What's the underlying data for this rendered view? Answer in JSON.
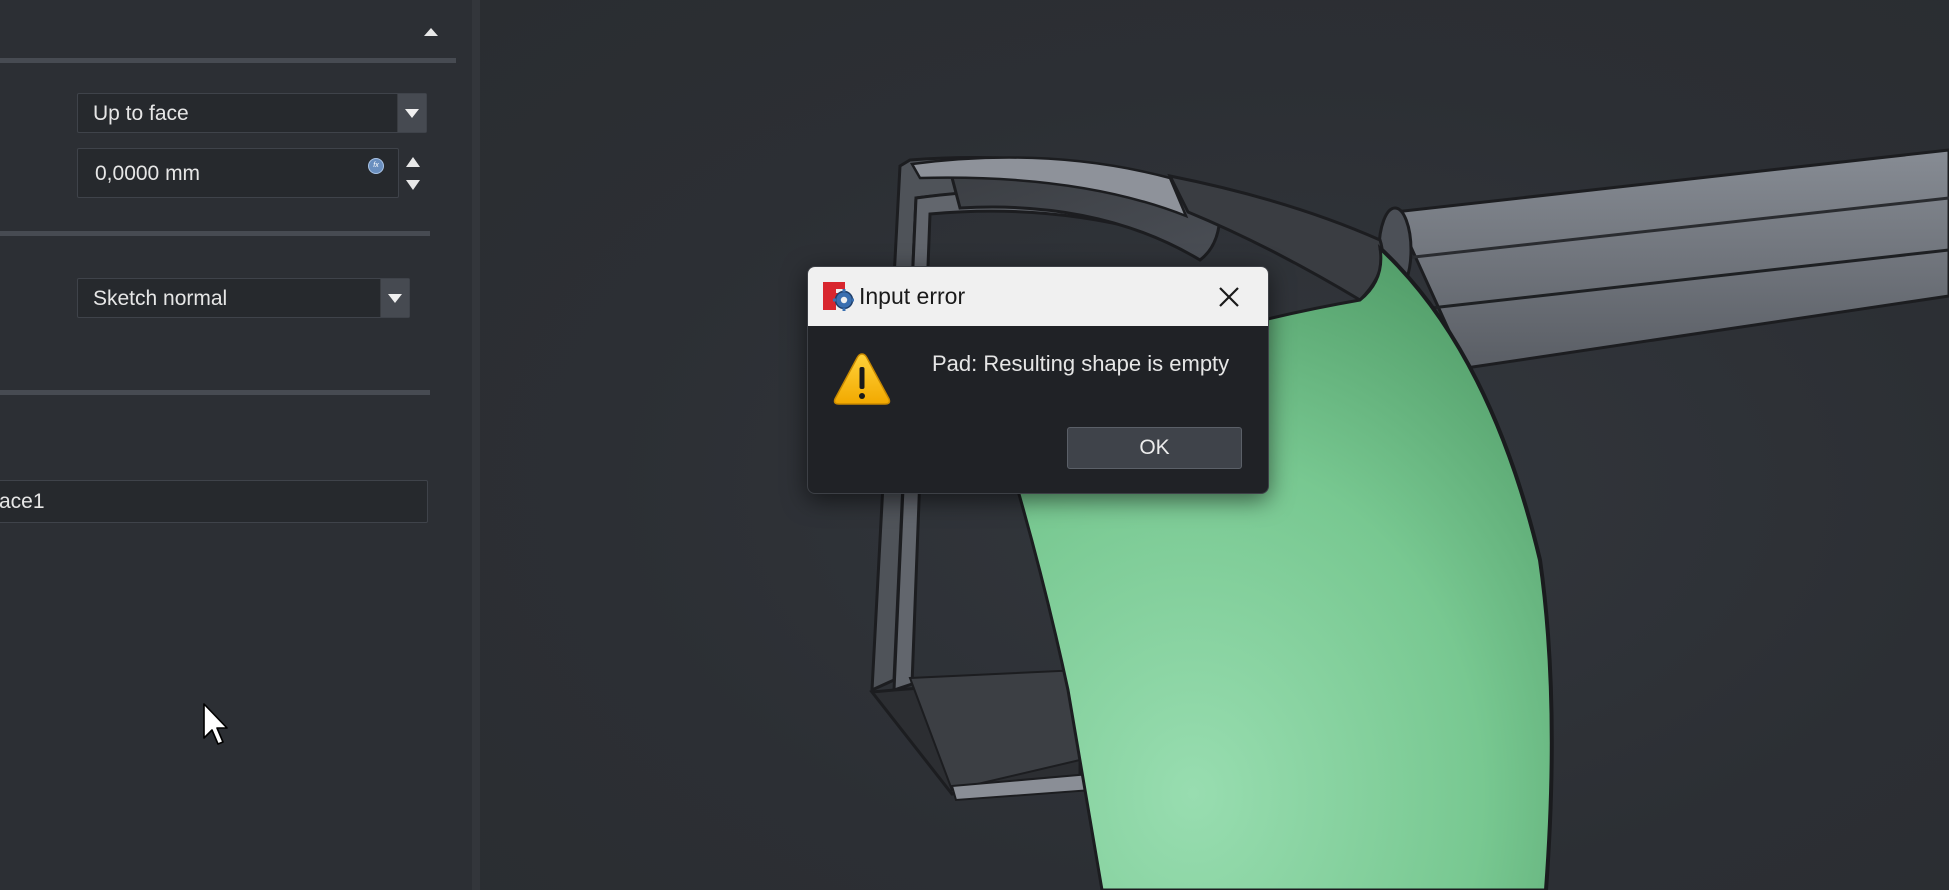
{
  "task_panel": {
    "type_combo": {
      "value": "Up to face"
    },
    "length_field": {
      "value": "0,0000 mm"
    },
    "direction_combo": {
      "value": "Sketch normal"
    },
    "face_field": {
      "value": "ace1"
    }
  },
  "dialog": {
    "title": "Input error",
    "message": "Pad: Resulting shape is empty",
    "ok_label": "OK",
    "icon": "warning-icon"
  },
  "colors": {
    "viewport_bg": "#2b2e33",
    "selected_face": "#7fce9a",
    "model_gray": "#5f636a",
    "dialog_bg": "#202226",
    "dialog_titlebar": "#f0f0f0"
  }
}
